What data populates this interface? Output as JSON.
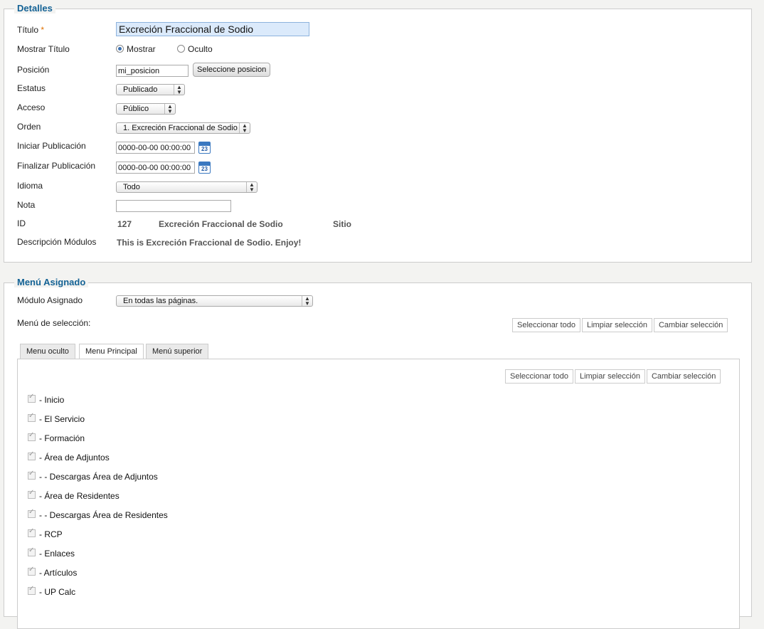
{
  "details": {
    "legend": "Detalles",
    "title_label": "Título",
    "title_required": "*",
    "title_value": "Excreción Fraccional de Sodio",
    "show_title_label": "Mostrar Título",
    "show_option": "Mostrar",
    "hide_option": "Oculto",
    "show_title_selected": "Mostrar",
    "position_label": "Posición",
    "position_value": "mi_posicion",
    "position_button": "Seleccione posicion",
    "status_label": "Estatus",
    "status_value": "Publicado",
    "access_label": "Acceso",
    "access_value": "Público",
    "order_label": "Orden",
    "order_value": "1. Excreción Fraccional de Sodio",
    "start_label": "Iniciar Publicación",
    "start_value": "0000-00-00 00:00:00",
    "finish_label": "Finalizar Publicación",
    "finish_value": "0000-00-00 00:00:00",
    "calendar_day": "23",
    "language_label": "Idioma",
    "language_value": "Todo",
    "note_label": "Nota",
    "note_value": "",
    "id_label": "ID",
    "id_value": "127",
    "id_name": "Excreción Fraccional de Sodio",
    "id_site": "Sitio",
    "description_label": "Descripción Módulos",
    "description_value": "This is Excreción Fraccional de Sodio. Enjoy!"
  },
  "menu": {
    "legend": "Menú Asignado",
    "assigned_label": "Módulo Asignado",
    "assigned_value": "En todas las páginas.",
    "selection_label": "Menú de selección:",
    "select_all": "Seleccionar todo",
    "clear_selection": "Limpiar selección",
    "toggle_selection": "Cambiar selección",
    "tabs": [
      {
        "label": "Menu oculto"
      },
      {
        "label": "Menu Principal"
      },
      {
        "label": "Menú superior"
      }
    ],
    "active_tab": "Menu Principal",
    "items": [
      {
        "label": "- Inicio",
        "checked": true
      },
      {
        "label": "- El Servicio",
        "checked": true
      },
      {
        "label": "- Formación",
        "checked": true
      },
      {
        "label": "- Área de Adjuntos",
        "checked": true
      },
      {
        "label": "- - Descargas Área de Adjuntos",
        "checked": true
      },
      {
        "label": "- Área de Residentes",
        "checked": true
      },
      {
        "label": "- - Descargas Área de Residentes",
        "checked": true
      },
      {
        "label": "- RCP",
        "checked": true
      },
      {
        "label": "- Enlaces",
        "checked": true
      },
      {
        "label": "- Artículos",
        "checked": true
      },
      {
        "label": "- UP Calc",
        "checked": true
      }
    ]
  }
}
